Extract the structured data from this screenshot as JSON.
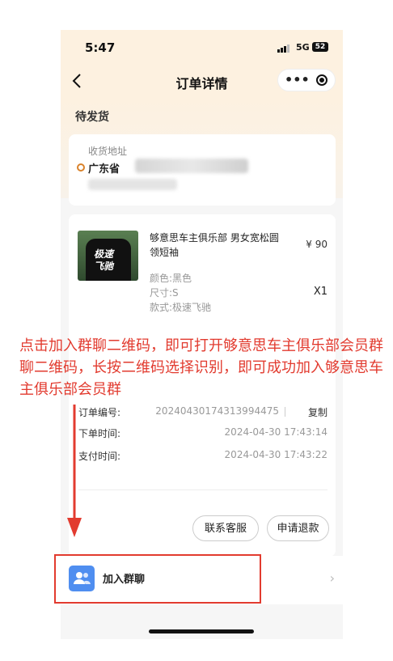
{
  "status": {
    "time": "5:47",
    "network": "5G",
    "battery": "52"
  },
  "nav": {
    "title": "订单详情",
    "more": "•••"
  },
  "order": {
    "state": "待发货"
  },
  "address": {
    "label": "收货地址",
    "line1": "广东省"
  },
  "product": {
    "name": "够意思车主俱乐部 男女宽松圆领短袖",
    "price": "¥ 90",
    "color": "颜色:黑色",
    "size": "尺寸:S",
    "style": "款式:极速飞驰",
    "qty": "X1",
    "thumb_text": "极速 飞驰"
  },
  "meta": [
    {
      "label": "订单编号:",
      "value": "20240430174313994475"
    },
    {
      "label": "下单时间:",
      "value": "2024-04-30 17:43:14"
    },
    {
      "label": "支付时间:",
      "value": "2024-04-30 17:43:22"
    }
  ],
  "copy_label": "复制",
  "buttons": {
    "service": "联系客服",
    "refund": "申请退款"
  },
  "join": {
    "label": "加入群聊"
  },
  "annotation": "点击加入群聊二维码，即可打开够意思车主俱乐部会员群聊二维码，长按二维码选择识别，即可成功加入够意思车主俱乐部会员群",
  "colors": {
    "annotation": "#e23b2f",
    "header_bg": "#fdf1e0",
    "join_icon": "#4f8ef0"
  }
}
